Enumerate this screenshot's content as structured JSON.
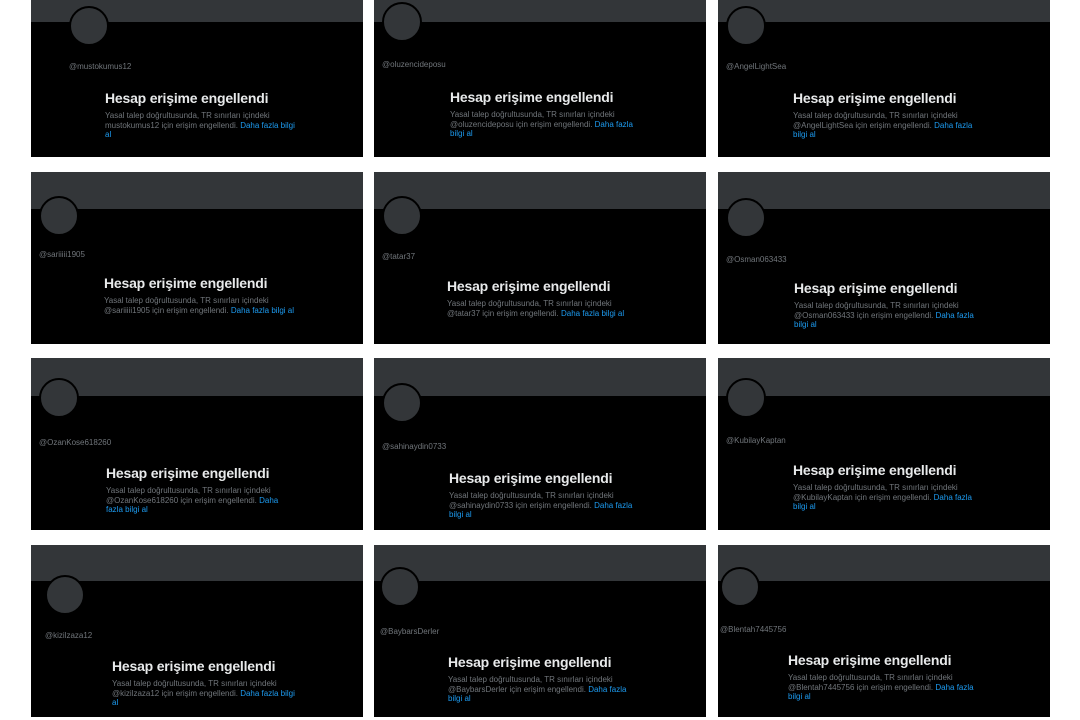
{
  "message": {
    "title": "Hesap erişime engellendi",
    "body_before": "Yasal talep doğrultusunda, TR sınırları içindeki ",
    "body_after": " için erişim engellendi. ",
    "link": "Daha fazla bilgi al"
  },
  "accounts": [
    {
      "handle": "@mustokumus12",
      "name": "mustokumus12"
    },
    {
      "handle": "@oluzencideposu",
      "name": "@oluzencideposu"
    },
    {
      "handle": "@AngelLightSea",
      "name": "@AngelLightSea"
    },
    {
      "handle": "@sariiiii1905",
      "name": "@sariiiii1905"
    },
    {
      "handle": "@tatar37",
      "name": "@tatar37"
    },
    {
      "handle": "@Osman063433",
      "name": "@Osman063433"
    },
    {
      "handle": "@OzanKose618260",
      "name": "@OzanKose618260"
    },
    {
      "handle": "@sahinaydin0733",
      "name": "@sahinaydin0733"
    },
    {
      "handle": "@KubilayKaptan",
      "name": "@KubilayKaptan"
    },
    {
      "handle": "@kizilzaza12",
      "name": "@kizilzaza12"
    },
    {
      "handle": "@BaybarsDerler",
      "name": "@BaybarsDerler"
    },
    {
      "handle": "@Blentah7445756",
      "name": "@Blentah7445756"
    }
  ]
}
